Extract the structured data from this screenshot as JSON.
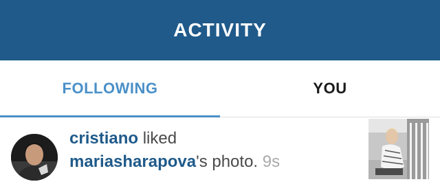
{
  "header": {
    "title": "ACTIVITY"
  },
  "tabs": [
    {
      "label": "FOLLOWING",
      "active": true
    },
    {
      "label": "YOU",
      "active": false
    }
  ],
  "activity": {
    "actor": "cristiano",
    "action": "liked",
    "target_user": "mariasharapova",
    "suffix": "'s photo.",
    "time": "9s"
  },
  "colors": {
    "header_bg": "#1f5a8a",
    "accent": "#4a90c8",
    "link": "#1f5a8a"
  }
}
